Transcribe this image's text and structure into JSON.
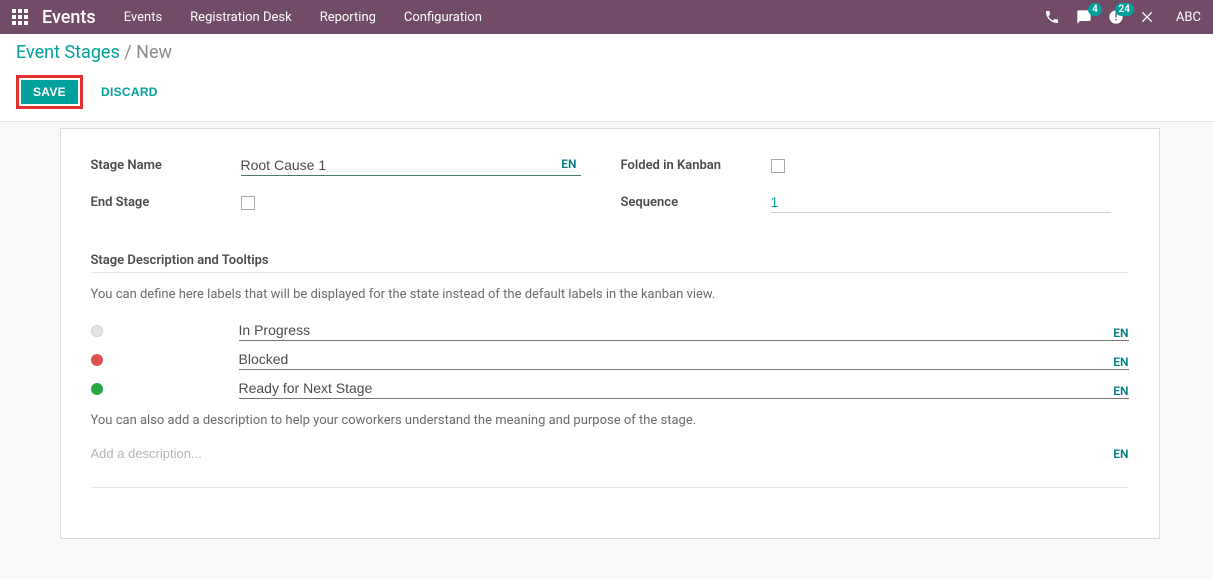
{
  "navbar": {
    "brand": "Events",
    "links": [
      "Events",
      "Registration Desk",
      "Reporting",
      "Configuration"
    ],
    "messages_badge": "4",
    "activities_badge": "24",
    "user": "ABC"
  },
  "breadcrumb": {
    "parent": "Event Stages",
    "separator": "/",
    "current": "New"
  },
  "actions": {
    "save": "SAVE",
    "discard": "DISCARD"
  },
  "form": {
    "labels": {
      "stage_name": "Stage Name",
      "end_stage": "End Stage",
      "folded": "Folded in Kanban",
      "sequence": "Sequence"
    },
    "values": {
      "stage_name": "Root Cause 1",
      "end_stage": false,
      "folded": false,
      "sequence": "1"
    },
    "lang": "EN"
  },
  "section": {
    "title": "Stage Description and Tooltips",
    "help1": "You can define here labels that will be displayed for the state instead of the default labels in the kanban view.",
    "help2": "You can also add a description to help your coworkers understand the meaning and purpose of the stage."
  },
  "status_labels": {
    "grey": "In Progress",
    "red": "Blocked",
    "green": "Ready for Next Stage"
  },
  "description": {
    "placeholder": "Add a description...",
    "value": ""
  }
}
